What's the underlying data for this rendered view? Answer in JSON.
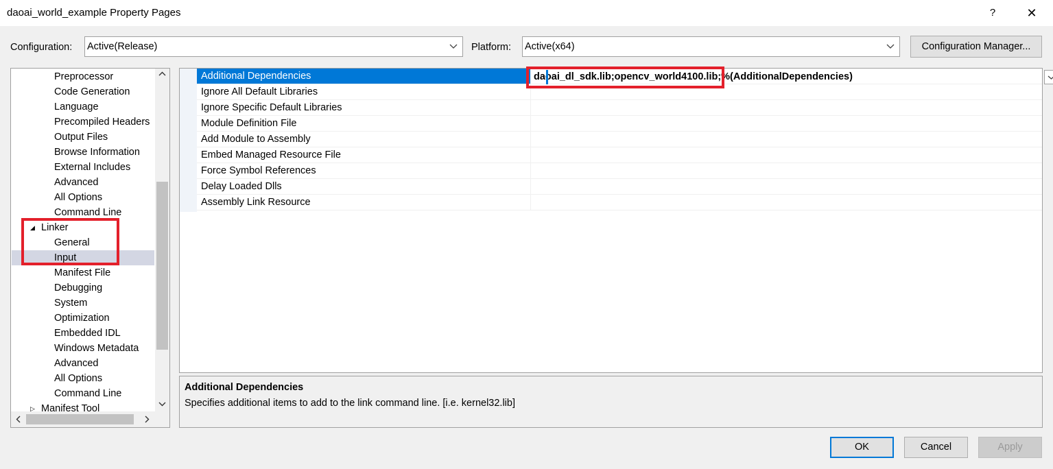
{
  "window": {
    "title": "daoai_world_example Property Pages",
    "help_label": "?",
    "close_label": "✕"
  },
  "toolbar": {
    "configuration_label": "Configuration:",
    "configuration_value": "Active(Release)",
    "platform_label": "Platform:",
    "platform_value": "Active(x64)",
    "config_manager_label": "Configuration Manager..."
  },
  "tree": {
    "items": [
      {
        "label": "Preprocessor"
      },
      {
        "label": "Code Generation"
      },
      {
        "label": "Language"
      },
      {
        "label": "Precompiled Headers"
      },
      {
        "label": "Output Files"
      },
      {
        "label": "Browse Information"
      },
      {
        "label": "External Includes"
      },
      {
        "label": "Advanced"
      },
      {
        "label": "All Options"
      },
      {
        "label": "Command Line"
      },
      {
        "label": "Linker",
        "expander": "◢"
      },
      {
        "label": "General"
      },
      {
        "label": "Input"
      },
      {
        "label": "Manifest File"
      },
      {
        "label": "Debugging"
      },
      {
        "label": "System"
      },
      {
        "label": "Optimization"
      },
      {
        "label": "Embedded IDL"
      },
      {
        "label": "Windows Metadata"
      },
      {
        "label": "Advanced"
      },
      {
        "label": "All Options"
      },
      {
        "label": "Command Line"
      },
      {
        "label": "Manifest Tool",
        "expander": "▷"
      }
    ]
  },
  "properties": {
    "rows": [
      {
        "name": "Additional Dependencies",
        "value": "daoai_dl_sdk.lib;opencv_world4100.lib;%(AdditionalDependencies)"
      },
      {
        "name": "Ignore All Default Libraries",
        "value": ""
      },
      {
        "name": "Ignore Specific Default Libraries",
        "value": ""
      },
      {
        "name": "Module Definition File",
        "value": ""
      },
      {
        "name": "Add Module to Assembly",
        "value": ""
      },
      {
        "name": "Embed Managed Resource File",
        "value": ""
      },
      {
        "name": "Force Symbol References",
        "value": ""
      },
      {
        "name": "Delay Loaded Dlls",
        "value": ""
      },
      {
        "name": "Assembly Link Resource",
        "value": ""
      }
    ]
  },
  "description": {
    "title": "Additional Dependencies",
    "text": "Specifies additional items to add to the link command line. [i.e. kernel32.lib]"
  },
  "buttons": {
    "ok": "OK",
    "cancel": "Cancel",
    "apply": "Apply"
  },
  "colors": {
    "accent": "#0078d7",
    "highlight": "#e3202b",
    "tree_selection": "#d3d6e3"
  }
}
